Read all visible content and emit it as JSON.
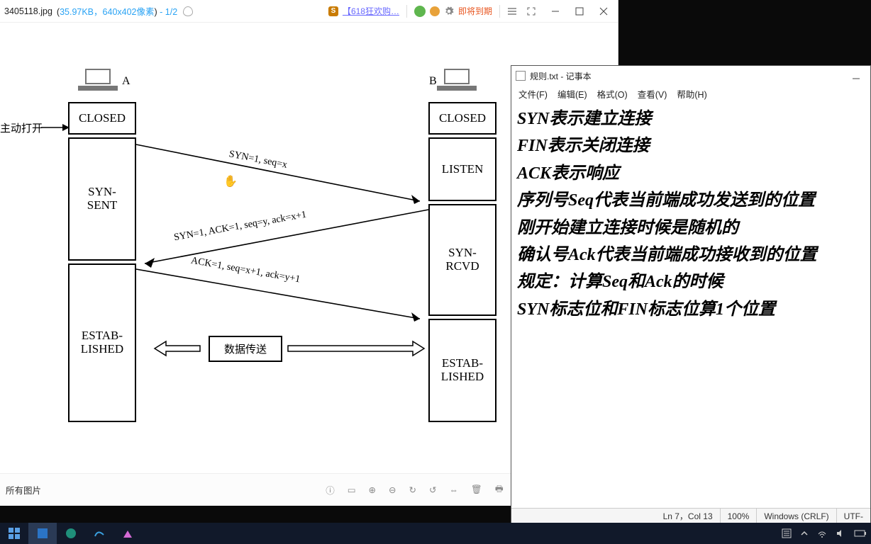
{
  "viewer": {
    "filename": "3405118.jpg",
    "size": "35.97KB",
    "dims_prefix": "，",
    "dims": "640x402像素",
    "frac": " - 1/2",
    "promo": "【618狂欢购…",
    "expiry": "即将到期",
    "open_label": "主动打开",
    "host_A": "A",
    "host_B": "B",
    "states": {
      "a_closed": "CLOSED",
      "a_syn_sent": "SYN-\nSENT",
      "a_estab": "ESTAB-\nLISHED",
      "b_closed": "CLOSED",
      "b_listen": "LISTEN",
      "b_syn_rcvd": "SYN-\nRCVD",
      "b_estab": "ESTAB-\nLISHED"
    },
    "msgs": {
      "m1": "SYN=1, seq=x",
      "m2": "SYN=1, ACK=1, seq=y, ack=x+1",
      "m3": "ACK=1, seq=x+1, ack=y+1"
    },
    "data_transfer": "数据传送",
    "all_images": "所有图片"
  },
  "notepad": {
    "title": "规则.txt - 记事本",
    "menu": {
      "file": "文件(F)",
      "edit": "编辑(E)",
      "format": "格式(O)",
      "view": "查看(V)",
      "help": "帮助(H)"
    },
    "lines": {
      "l1": "SYN表示建立连接",
      "l2": "FIN表示关闭连接",
      "l3": "ACK表示响应",
      "l4": "",
      "l5": "序列号Seq代表当前端成功发送到的位置",
      "l6": "刚开始建立连接时候是随机的",
      "l7": "确认号Ack代表当前端成功接收到的位置",
      "l8": "规定：计算Seq和Ack的时候",
      "l9": "SYN标志位和FIN标志位算1个位置"
    },
    "status": {
      "pos": "Ln 7，Col 13",
      "zoom": "100%",
      "eol": "Windows (CRLF)",
      "enc": "UTF-"
    }
  },
  "chart_data": {
    "type": "sequence-diagram",
    "title": "TCP three-way handshake",
    "hosts": [
      "A",
      "B"
    ],
    "states": {
      "A": [
        "CLOSED",
        "SYN-SENT",
        "ESTABLISHED"
      ],
      "B": [
        "CLOSED",
        "LISTEN",
        "SYN-RCVD",
        "ESTABLISHED"
      ]
    },
    "annotations": {
      "A_opens": "主动打开"
    },
    "messages": [
      {
        "from": "A",
        "to": "B",
        "label": "SYN=1, seq=x"
      },
      {
        "from": "B",
        "to": "A",
        "label": "SYN=1, ACK=1, seq=y, ack=x+1"
      },
      {
        "from": "A",
        "to": "B",
        "label": "ACK=1, seq=x+1, ack=y+1"
      }
    ],
    "data_transfer_label": "数据传送"
  }
}
